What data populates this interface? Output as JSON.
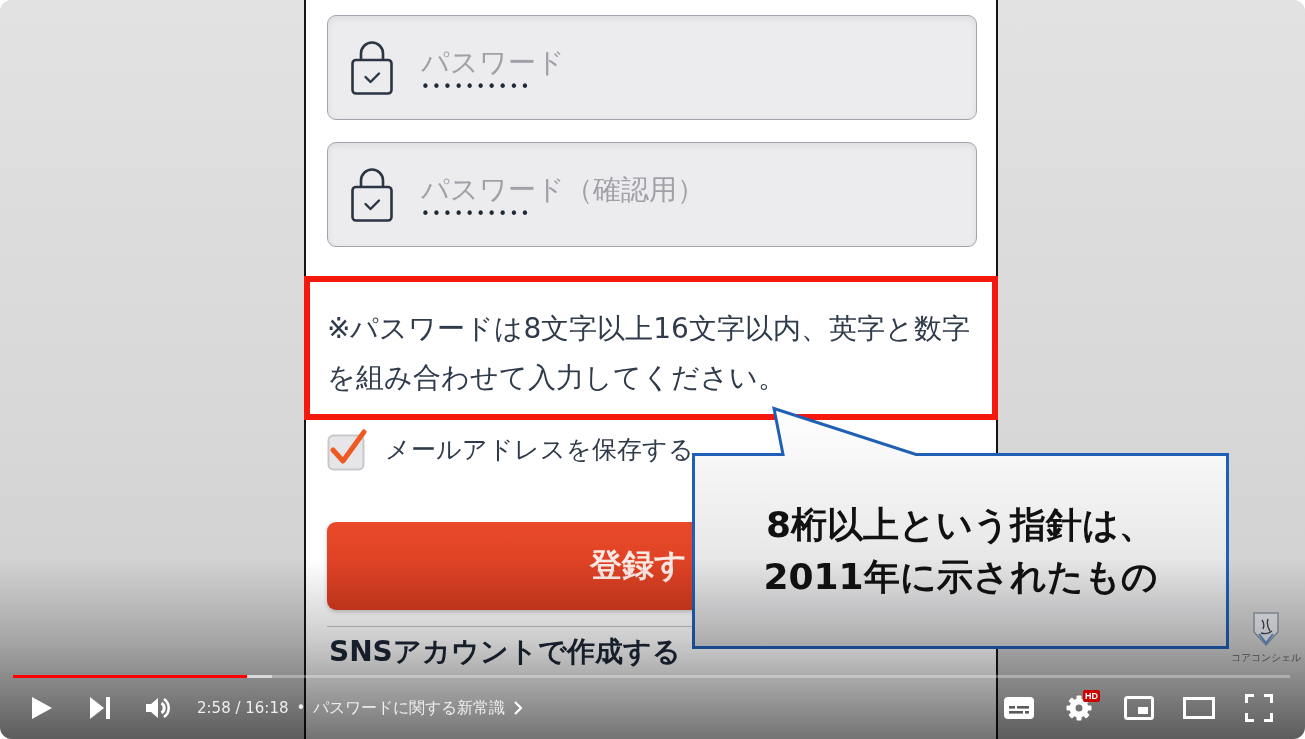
{
  "video_frame": {
    "password_fields": [
      {
        "placeholder": "パスワード",
        "masked_value": "••••••••••"
      },
      {
        "placeholder": "パスワード（確認用）",
        "masked_value": "••••••••••"
      }
    ],
    "password_note": {
      "lines": [
        "※パスワードは8文字以上16文字以内、英字と数字",
        "を組み合わせて入力してください。"
      ],
      "highlighted": true
    },
    "save_email_checkbox": {
      "label": "メールアドレスを保存する",
      "checked": true
    },
    "register_button": {
      "label": "登録す"
    },
    "sns_section_heading": "SNSアカウントで作成する",
    "callout": {
      "lines": [
        "8桁以上という指針は、",
        "2011年に示されたもの"
      ]
    },
    "channel_logo": {
      "text": "コアコンシェル"
    }
  },
  "player_controls": {
    "progress": {
      "level": 0.183,
      "buffer": {
        "level": 0.203
      }
    },
    "playing": false,
    "time": "2:58 / 16:18",
    "separator": "•",
    "chapter_title": "パスワードに関する新常識",
    "settings_badge": "HD"
  }
}
